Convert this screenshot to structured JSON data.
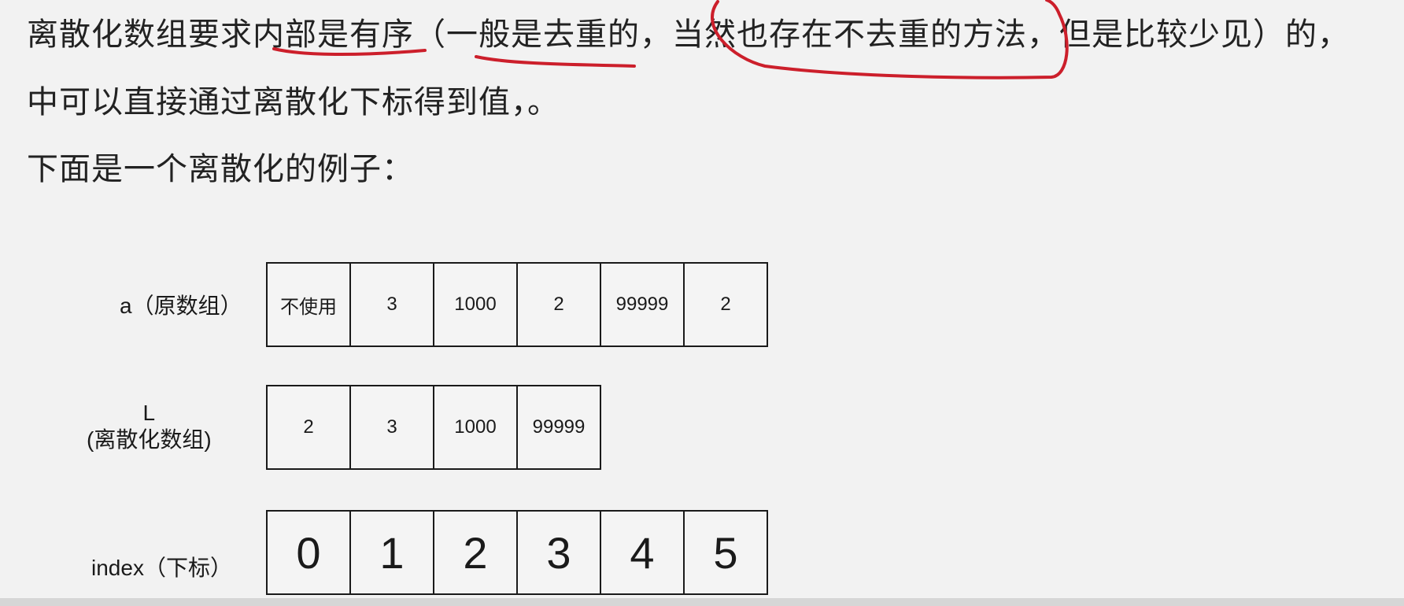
{
  "text": {
    "line1": "离散化数组要求内部是有序（一般是去重的，当然也存在不去重的方法，但是比较少见）的，",
    "line2": "中可以直接通过离散化下标得到值，。",
    "line3": "下面是一个离散化的例子："
  },
  "table": {
    "rows": [
      {
        "label": "a（原数组）",
        "cells": [
          "不使用",
          "3",
          "1000",
          "2",
          "99999",
          "2"
        ]
      },
      {
        "label_line1": "L",
        "label_line2": "(离散化数组)",
        "cells": [
          "2",
          "3",
          "1000",
          "99999"
        ]
      },
      {
        "label": "index（下标）",
        "cells": [
          "0",
          "1",
          "2",
          "3",
          "4",
          "5"
        ]
      }
    ]
  },
  "colors": {
    "annotation": "#cc1f2b",
    "background": "#f2f2f2",
    "text": "#222222"
  }
}
